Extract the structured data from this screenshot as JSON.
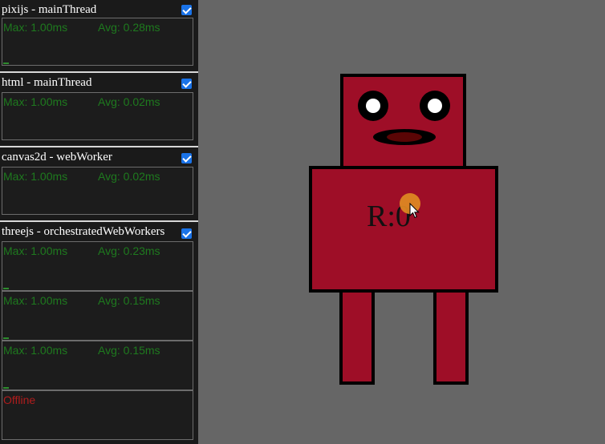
{
  "panels": [
    {
      "title": "pixijs - mainThread",
      "checked": true,
      "graphs": [
        {
          "max": "Max: 1.00ms",
          "avg": "Avg: 0.28ms"
        }
      ]
    },
    {
      "title": "html - mainThread",
      "checked": true,
      "graphs": [
        {
          "max": "Max: 1.00ms",
          "avg": "Avg: 0.02ms"
        }
      ]
    },
    {
      "title": "canvas2d - webWorker",
      "checked": true,
      "graphs": [
        {
          "max": "Max: 1.00ms",
          "avg": "Avg: 0.02ms"
        }
      ]
    },
    {
      "title": "threejs - orchestratedWebWorkers",
      "checked": true,
      "graphs": [
        {
          "max": "Max: 1.00ms",
          "avg": "Avg: 0.23ms"
        },
        {
          "max": "Max: 1.00ms",
          "avg": "Avg: 0.15ms"
        },
        {
          "max": "Max: 1.00ms",
          "avg": "Avg: 0.15ms"
        },
        {
          "status": "Offline"
        }
      ]
    }
  ],
  "scene": {
    "rotation_label": "R:0",
    "colors": {
      "background": "#666666",
      "robot_body": "#9e0e27",
      "outline": "#000000",
      "cursor_dot": "#e08a22"
    }
  }
}
